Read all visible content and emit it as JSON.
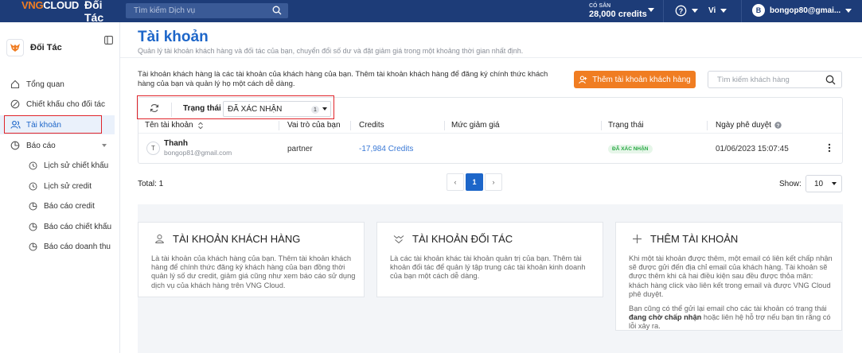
{
  "topbar": {
    "brand_vng": "VNG",
    "brand_cloud": "CLOUD",
    "brand_partner": "Đối Tác",
    "search_placeholder": "Tìm kiếm Dịch vụ",
    "credits_label": "CÓ SẴN",
    "credits_value": "28,000 credits",
    "help_icon": "help-circle-icon",
    "language": "Vi",
    "user_initial": "B",
    "user_email": "bongop80@gmai..."
  },
  "sidebar": {
    "title": "Đối Tác",
    "items": [
      {
        "label": "Tổng quan",
        "icon": "dashboard-icon"
      },
      {
        "label": "Chiết khấu cho đối tác",
        "icon": "discount-icon"
      },
      {
        "label": "Tài khoản",
        "icon": "users-icon",
        "active": true
      },
      {
        "label": "Báo cáo",
        "icon": "report-icon"
      }
    ],
    "sub_items": [
      {
        "label": "Lịch sử chiết khấu"
      },
      {
        "label": "Lịch sử credit"
      },
      {
        "label": "Báo cáo credit"
      },
      {
        "label": "Báo cáo chiết khấu"
      },
      {
        "label": "Báo cáo doanh thu"
      }
    ]
  },
  "main": {
    "title": "Tài khoản",
    "subtitle": "Quản lý tài khoản khách hàng và đối tác của bạn, chuyển đổi số dư và đặt giảm giá trong một khoảng thời gian nhất định.",
    "description": "Tài khoản khách hàng là các tài khoản của khách hàng của bạn. Thêm tài khoản khách hàng để đăng ký chính thức khách hàng của bạn và quản lý họ một cách dễ dàng.",
    "add_button": "Thêm tài khoản khách hàng",
    "search_placeholder": "Tìm kiếm khách hàng",
    "filter": {
      "label": "Trạng thái",
      "value": "ĐÃ XÁC NHẬN",
      "count": "1"
    },
    "table": {
      "columns": [
        "Tên tài khoản",
        "Vai trò của bạn",
        "Credits",
        "Mức giảm giá",
        "Trạng thái",
        "Ngày phê duyệt"
      ],
      "rows": [
        {
          "initial": "T",
          "name": "Thanh",
          "email": "bongop81@gmail.com",
          "role": "partner",
          "credits": "-17,984 Credits",
          "discount": "",
          "status": "ĐÃ XÁC NHẬN",
          "approved": "01/06/2023 15:07:45"
        }
      ]
    },
    "total": "Total: 1",
    "pagination": {
      "prev": "‹",
      "current": "1",
      "next": "›"
    },
    "show_label": "Show:",
    "show_value": "10",
    "info_cards": [
      {
        "title": "TÀI KHOẢN KHÁCH HÀNG",
        "icon": "user-icon",
        "body": "Là tài khoản của khách hàng của bạn. Thêm tài khoản khách hàng để chính thức đăng ký khách hàng của bạn đồng thời quản lý số dư credit, giảm giá cũng như xem báo cáo sử dụng dịch vụ của khách hàng trên VNG Cloud."
      },
      {
        "title": "TÀI KHOẢN ĐỐI TÁC",
        "icon": "partner-icon",
        "body": "Là các tài khoản khác tài khoản quản trị của bạn. Thêm tài khoản đối tác để quản lý tập trung các tài khoản kinh doanh của bạn một cách dễ dàng."
      },
      {
        "title": "THÊM TÀI KHOẢN",
        "icon": "plus-icon",
        "body": "Khi một tài khoản được thêm, một email có liên kết chấp nhận sẽ được gửi đến địa chỉ email của khách hàng. Tài khoản sẽ được thêm khi cả hai điều kiện sau đều được thỏa mãn: khách hàng click vào liên kết trong email và được VNG Cloud phê duyệt.",
        "body2_a": "Bạn cũng có thể gửi lại email cho các tài khoản có trạng thái ",
        "body2_bold": "đang chờ chấp nhận",
        "body2_b": " hoặc liên hệ hỗ trợ nếu bạn tin rằng có lỗi xảy ra."
      }
    ]
  },
  "colors": {
    "topbar": "#1d3c78",
    "brand_orange": "#f07d22",
    "primary_blue": "#1d66c9",
    "highlight_red": "#e0242a",
    "status_green": "#27a843"
  }
}
